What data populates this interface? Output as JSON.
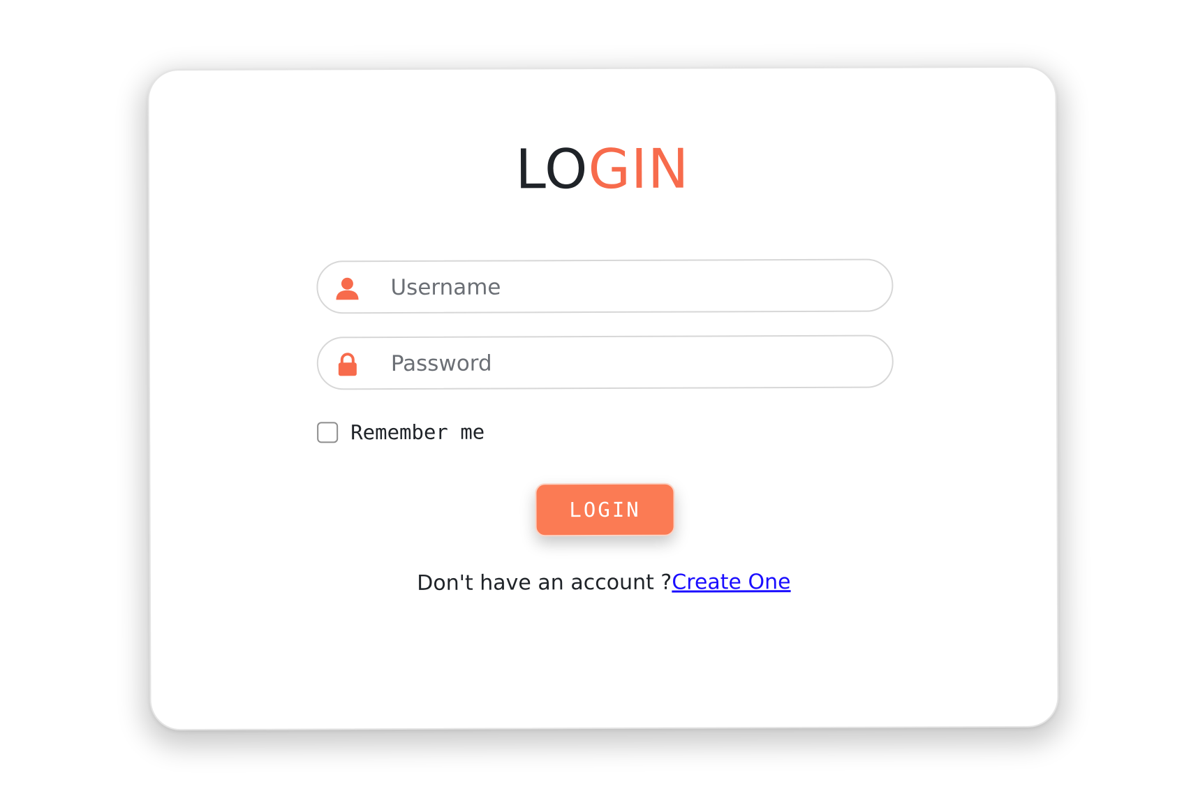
{
  "title": {
    "part1": "LO",
    "part2": "GIN"
  },
  "form": {
    "username_placeholder": "Username",
    "password_placeholder": "Password",
    "remember_label": "Remember me",
    "login_button": "LOGIN"
  },
  "footer": {
    "prompt": "Don't have an account ?",
    "link": "Create One"
  },
  "icons": {
    "username": "user-icon",
    "password": "lock-icon"
  },
  "colors": {
    "accent": "#f76b4c",
    "button": "#fb7b54",
    "link": "#1a0dff",
    "dark_text": "#1f2328"
  }
}
